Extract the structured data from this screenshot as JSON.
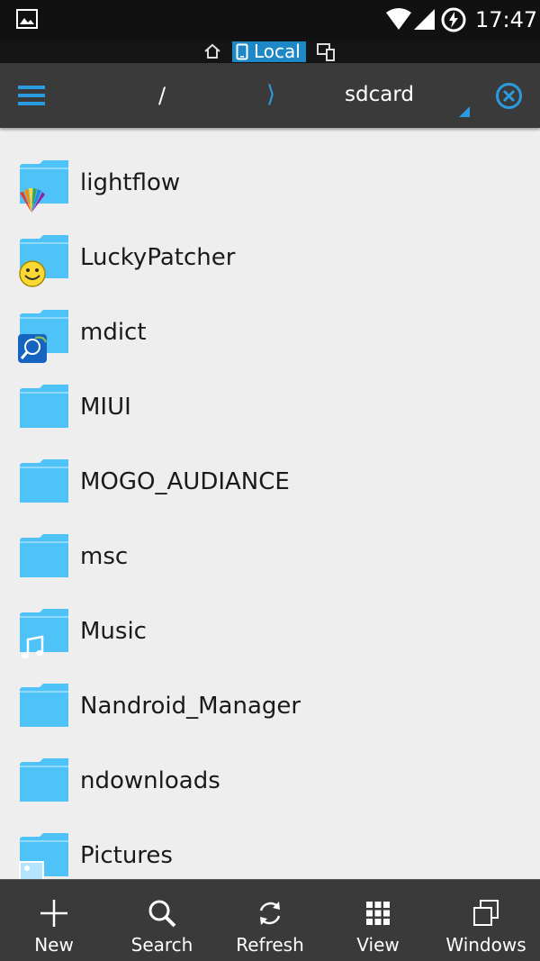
{
  "status_bar": {
    "time": "17:47"
  },
  "location_bar": {
    "active_storage": "Local"
  },
  "toolbar": {
    "root": "/",
    "separator": "⟩",
    "current": "sdcard"
  },
  "files": [
    {
      "name": "lightflow",
      "badge": "lightflow-app-icon"
    },
    {
      "name": "LuckyPatcher",
      "badge": "smiley-app-icon"
    },
    {
      "name": "mdict",
      "badge": "mdict-app-icon"
    },
    {
      "name": "MIUI",
      "badge": ""
    },
    {
      "name": "MOGO_AUDIANCE",
      "badge": ""
    },
    {
      "name": "msc",
      "badge": ""
    },
    {
      "name": "Music",
      "badge": "music-note-icon"
    },
    {
      "name": "Nandroid_Manager",
      "badge": ""
    },
    {
      "name": "ndownloads",
      "badge": ""
    },
    {
      "name": "Pictures",
      "badge": "picture-icon"
    }
  ],
  "bottom_bar": {
    "new": "New",
    "search": "Search",
    "refresh": "Refresh",
    "view": "View",
    "windows": "Windows"
  },
  "colors": {
    "accent": "#2b9be0",
    "folder": "#4fc3f7",
    "toolbar": "#3a3a3a",
    "status_bar": "#111111"
  }
}
